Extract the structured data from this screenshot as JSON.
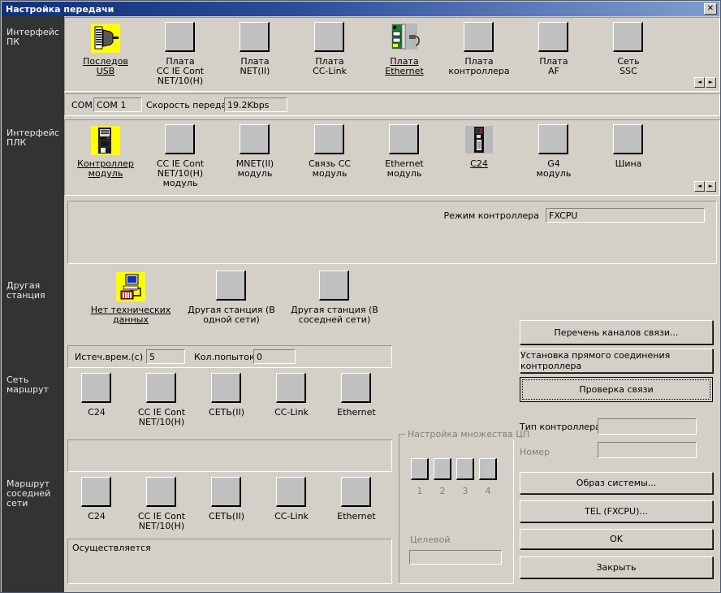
{
  "window": {
    "title": "Настройка передачи",
    "close_label": "✕"
  },
  "sidebar": {
    "items": [
      {
        "label": "Интерфейс\nПК"
      },
      {
        "label": "Интерфейс\nПЛК"
      },
      {
        "label": "Другая\nстанция"
      },
      {
        "label": "Сеть\nмаршрут"
      },
      {
        "label": "Маршрут\nсоседней\nсети"
      }
    ]
  },
  "pc_interface": {
    "devices": [
      {
        "label": "Последов\nUSB",
        "icon": "usb-serial-icon",
        "selected": true
      },
      {
        "label": "Плата\nCC IE Cont\nNET/10(H)",
        "icon": "blank-plate-icon",
        "selected": false
      },
      {
        "label": "Плата\nNET(II)",
        "icon": "blank-plate-icon",
        "selected": false
      },
      {
        "label": "Плата\nCC-Link",
        "icon": "blank-plate-icon",
        "selected": false
      },
      {
        "label": "Плата\nEthernet",
        "icon": "ethernet-board-icon",
        "selected": true
      },
      {
        "label": "Плата\nконтроллера",
        "icon": "blank-plate-icon",
        "selected": false
      },
      {
        "label": "Плата\nAF",
        "icon": "blank-plate-icon",
        "selected": false
      },
      {
        "label": "Сеть\nSSC",
        "icon": "blank-plate-icon",
        "selected": false
      }
    ],
    "scroll_left": "◄",
    "scroll_right": "►"
  },
  "serial_settings": {
    "com_label": "COM",
    "com_value": "COM 1",
    "speed_label": "Скорость передачи",
    "speed_value": "19.2Kbps"
  },
  "plc_interface": {
    "devices": [
      {
        "label": "Контроллер\nмодуль",
        "icon": "plc-cpu-module-icon",
        "selected": true
      },
      {
        "label": "CC IE Cont\nNET/10(H)\nмодуль",
        "icon": "blank-plate-icon",
        "selected": false
      },
      {
        "label": "MNET(II)\nмодуль",
        "icon": "blank-plate-icon",
        "selected": false
      },
      {
        "label": "Связь СС\nмодуль",
        "icon": "blank-plate-icon",
        "selected": false
      },
      {
        "label": "Ethernet\nмодуль",
        "icon": "blank-plate-icon",
        "selected": false
      },
      {
        "label": "C24",
        "icon": "c24-module-icon",
        "selected": true
      },
      {
        "label": "G4\nмодуль",
        "icon": "blank-plate-icon",
        "selected": false
      },
      {
        "label": "Шина",
        "icon": "blank-plate-icon",
        "selected": false
      }
    ],
    "scroll_left": "◄",
    "scroll_right": "►"
  },
  "cpu_mode": {
    "label": "Режим контроллера",
    "value": "FXCPU"
  },
  "other_station": {
    "devices": [
      {
        "label": "Нет технических\nданных",
        "icon": "no-specification-icon",
        "selected": true
      },
      {
        "label": "Другая станция (В\nодной сети)",
        "icon": "blank-plate-icon",
        "selected": false
      },
      {
        "label": "Другая станция (В\nсоседней сети)",
        "icon": "blank-plate-icon",
        "selected": false
      }
    ],
    "timeout_label": "Истеч.врем.(с)",
    "timeout_value": "5",
    "retry_label": "Кол.попыток",
    "retry_value": "0"
  },
  "network_route": {
    "devices": [
      {
        "label": "C24",
        "icon": "blank-plate-icon"
      },
      {
        "label": "CC IE Cont\nNET/10(H)",
        "icon": "blank-plate-icon"
      },
      {
        "label": "СЕТЬ(II)",
        "icon": "blank-plate-icon"
      },
      {
        "label": "CC-Link",
        "icon": "blank-plate-icon"
      },
      {
        "label": "Ethernet",
        "icon": "blank-plate-icon"
      }
    ]
  },
  "coexist_route": {
    "devices": [
      {
        "label": "C24",
        "icon": "blank-plate-icon"
      },
      {
        "label": "CC IE Cont\nNET/10(H)",
        "icon": "blank-plate-icon"
      },
      {
        "label": "СЕТЬ(II)",
        "icon": "blank-plate-icon"
      },
      {
        "label": "CC-Link",
        "icon": "blank-plate-icon"
      },
      {
        "label": "Ethernet",
        "icon": "blank-plate-icon"
      }
    ]
  },
  "status": {
    "text": "Осуществляется"
  },
  "multi_cpu": {
    "legend": "Настройка множества ЦП",
    "slots": [
      "1",
      "2",
      "3",
      "4"
    ],
    "target_label": "Целевой",
    "target_value": ""
  },
  "actions": {
    "channel_list": "Перечень каналов связи...",
    "direct_connect": "Установка прямого соединения контроллера",
    "connection_test": "Проверка связи",
    "system_image": "Образ системы...",
    "tel": "TEL (FXCPU)...",
    "ok": "OK",
    "close": "Закрыть"
  },
  "plc_info": {
    "type_label": "Тип контроллера",
    "type_value": "",
    "number_label": "Номер",
    "number_value": ""
  },
  "colors": {
    "face": "#d4d0c8",
    "title_start": "#10307c",
    "title_end": "#7e9fd0",
    "sidebar": "#333333",
    "icon_highlight": "#ffff00"
  }
}
